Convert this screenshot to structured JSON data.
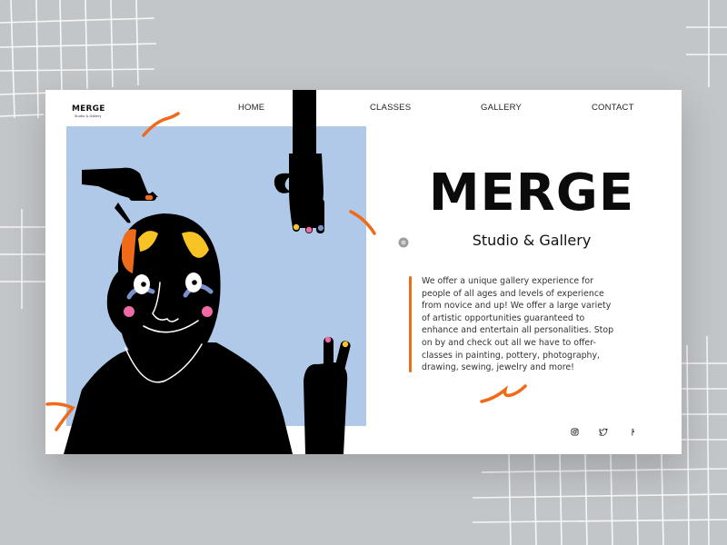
{
  "brand": {
    "name": "MERGE",
    "tagline": "Studio & Gallery"
  },
  "nav": {
    "items": [
      {
        "label": "HOME"
      },
      {
        "label": "CLASSES"
      },
      {
        "label": "GALLERY"
      },
      {
        "label": "CONTACT"
      }
    ]
  },
  "hero": {
    "title": "MERGE",
    "subtitle": "Studio & Gallery",
    "description": "We offer a unique gallery experience for people of all ages and levels of experience from novice and up! We offer a large variety of artistic opportunities guaranteed to enhance and entertain all personalities. Stop on by and check out all we have to offer- classes in painting, pottery, photography, drawing, sewing, jewelry and more!"
  },
  "social": {
    "icons": [
      "instagram-icon",
      "twitter-icon",
      "facebook-icon"
    ]
  },
  "colors": {
    "background": "#c3c6c9",
    "card": "#ffffff",
    "art_panel": "#b0c9e9",
    "accent": "#ef6b1a",
    "ink": "#0b0b0b",
    "yellow": "#f7c325",
    "pink": "#f06aa6",
    "brow_blue": "#7a92c9"
  }
}
